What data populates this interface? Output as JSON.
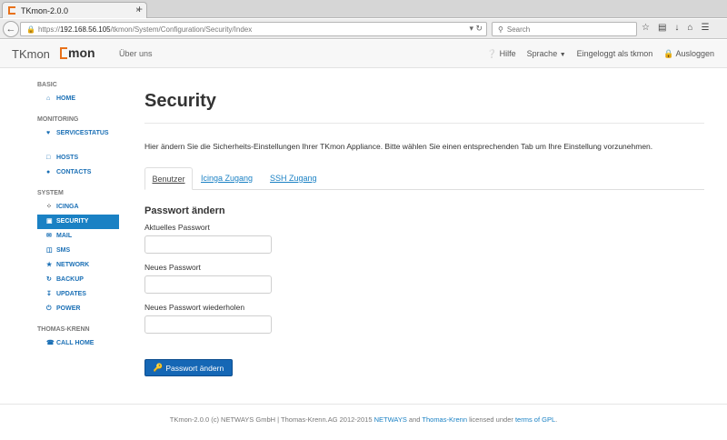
{
  "browser": {
    "tab_title": "TKmon-2.0.0",
    "close_glyph": "×",
    "new_tab_glyph": "+",
    "url_scheme": "https://",
    "url_host": "192.168.56.105",
    "url_path": "/tkmon/System/Configuration/Security/Index",
    "search_placeholder": "Search",
    "icons": [
      "star-icon",
      "reader-icon",
      "download-icon",
      "home-icon",
      "menu-icon"
    ]
  },
  "header": {
    "brand": "TKmon",
    "logo_text": "mon",
    "about": "Über uns",
    "help": "Hilfe",
    "language": "Sprache",
    "logged_in": "Eingeloggt als tkmon",
    "logout": "Ausloggen"
  },
  "sidebar": {
    "sections": [
      {
        "title": "BASIC",
        "items": [
          {
            "label": "HOME",
            "icon": "home-icon"
          }
        ]
      },
      {
        "title": "MONITORING",
        "items": [
          {
            "label": "SERVICESTATUS",
            "icon": "heart-icon"
          },
          {
            "label": "",
            "icon": ""
          },
          {
            "label": "HOSTS",
            "icon": "monitor-icon"
          },
          {
            "label": "CONTACTS",
            "icon": "user-icon"
          }
        ]
      },
      {
        "title": "SYSTEM",
        "items": [
          {
            "label": "ICINGA",
            "icon": "icinga-icon"
          },
          {
            "label": "SECURITY",
            "icon": "lock-icon",
            "active": true
          },
          {
            "label": "MAIL",
            "icon": "mail-icon"
          },
          {
            "label": "SMS",
            "icon": "sms-icon"
          },
          {
            "label": "NETWORK",
            "icon": "network-icon"
          },
          {
            "label": "BACKUP",
            "icon": "backup-icon"
          },
          {
            "label": "UPDATES",
            "icon": "download-icon"
          },
          {
            "label": "POWER",
            "icon": "power-icon"
          }
        ]
      },
      {
        "title": "THOMAS-KRENN",
        "items": [
          {
            "label": "CALL HOME",
            "icon": "phone-icon"
          }
        ]
      }
    ]
  },
  "main": {
    "title": "Security",
    "intro": "Hier ändern Sie die Sicherheits-Einstellungen Ihrer TKmon Appliance. Bitte wählen Sie einen entsprechenden Tab um Ihre Einstellung vorzunehmen.",
    "tabs": [
      {
        "label": "Benutzer"
      },
      {
        "label": "Icinga Zugang"
      },
      {
        "label": "SSH Zugang"
      }
    ],
    "form": {
      "title": "Passwort ändern",
      "current_label": "Aktuelles Passwort",
      "new_label": "Neues Passwort",
      "repeat_label": "Neues Passwort wiederholen",
      "submit_label": "Passwort ändern"
    }
  },
  "footer": {
    "prefix": "TKmon-2.0.0 (c) NETWAYS GmbH | Thomas-Krenn.AG 2012-2015 ",
    "netways": "NETWAYS",
    "and": " and ",
    "tk": "Thomas-Krenn",
    "licensed": " licensed under ",
    "gpl": "terms of GPL",
    "end": "."
  },
  "colors": {
    "accent": "#1a81c4",
    "button": "#1567b5",
    "logo_orange": "#e8711a"
  }
}
